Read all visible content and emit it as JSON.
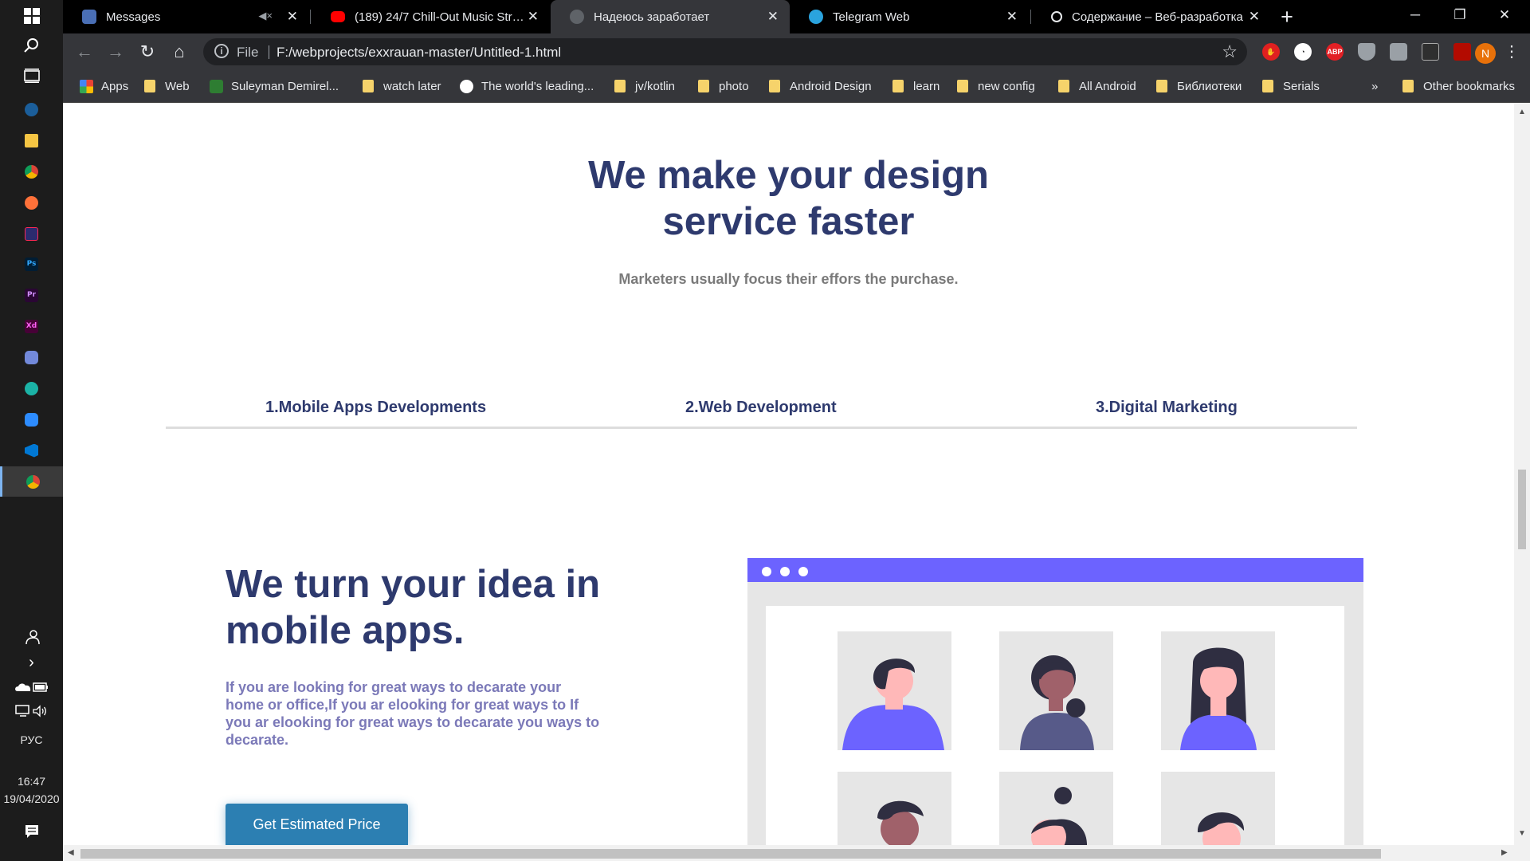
{
  "taskbar": {
    "icons": [
      "windows-start-icon",
      "search-icon",
      "task-view-icon",
      "steam-icon",
      "file-explorer-icon",
      "chrome-icon",
      "firefox-icon",
      "intellij-icon",
      "photoshop-icon",
      "premiere-icon",
      "adobe-xd-icon",
      "discord-icon",
      "gitkraken-icon",
      "zoom-icon",
      "vscode-icon",
      "chrome-active-icon"
    ],
    "ps_label": "Ps",
    "pr_label": "Pr",
    "xd_label": "Xd",
    "lang": "РУС",
    "time": "16:47",
    "date": "19/04/2020"
  },
  "tabs": [
    {
      "title": "Messages",
      "icon": "messages-icon"
    },
    {
      "title": "(189) 24/7 Chill-Out Music Stream",
      "icon": "youtube-icon"
    },
    {
      "title": "Надеюсь заработает",
      "icon": "globe-icon"
    },
    {
      "title": "Telegram Web",
      "icon": "telegram-icon"
    },
    {
      "title": "Содержание – Веб-разработка",
      "icon": "mdn-icon"
    }
  ],
  "toolbar": {
    "scheme": "File",
    "url": "F:/webprojects/exxrauan-master/Untitled-1.html",
    "profile_initial": "N",
    "abp_label": "ABP"
  },
  "bookmarks": [
    {
      "label": "Apps",
      "type": "apps"
    },
    {
      "label": "Web",
      "type": "folder"
    },
    {
      "label": "Suleyman Demirel...",
      "type": "site"
    },
    {
      "label": "watch later",
      "type": "folder"
    },
    {
      "label": "The world's leading...",
      "type": "github"
    },
    {
      "label": "jv/kotlin",
      "type": "folder"
    },
    {
      "label": "photo",
      "type": "folder"
    },
    {
      "label": "Android Design",
      "type": "folder"
    },
    {
      "label": "learn",
      "type": "folder"
    },
    {
      "label": "new config",
      "type": "folder"
    },
    {
      "label": "All Android",
      "type": "folder"
    },
    {
      "label": "Библиотеки",
      "type": "folder"
    },
    {
      "label": "Serials",
      "type": "folder"
    }
  ],
  "bookmarks_more": "»",
  "other_bookmarks": "Other bookmarks",
  "page": {
    "hero_title": "We make your design service faster",
    "hero_subtitle": "Marketers usually focus their effors the purchase.",
    "services": [
      "1.Mobile Apps Developments",
      "2.Web Development",
      "3.Digital Marketing"
    ],
    "idea_title": "We turn your idea in mobile apps.",
    "idea_text": "If you are looking for great ways to decarate your home or office,If you ar elooking for great ways to If you ar elooking for great ways to decarate you ways to decarate.",
    "cta": "Get Estimated Price"
  },
  "colors": {
    "heading": "#2e3a6e",
    "accent_purple": "#6c63ff",
    "cta_blue": "#2c7fb2",
    "body_purple": "#7b79b8"
  }
}
